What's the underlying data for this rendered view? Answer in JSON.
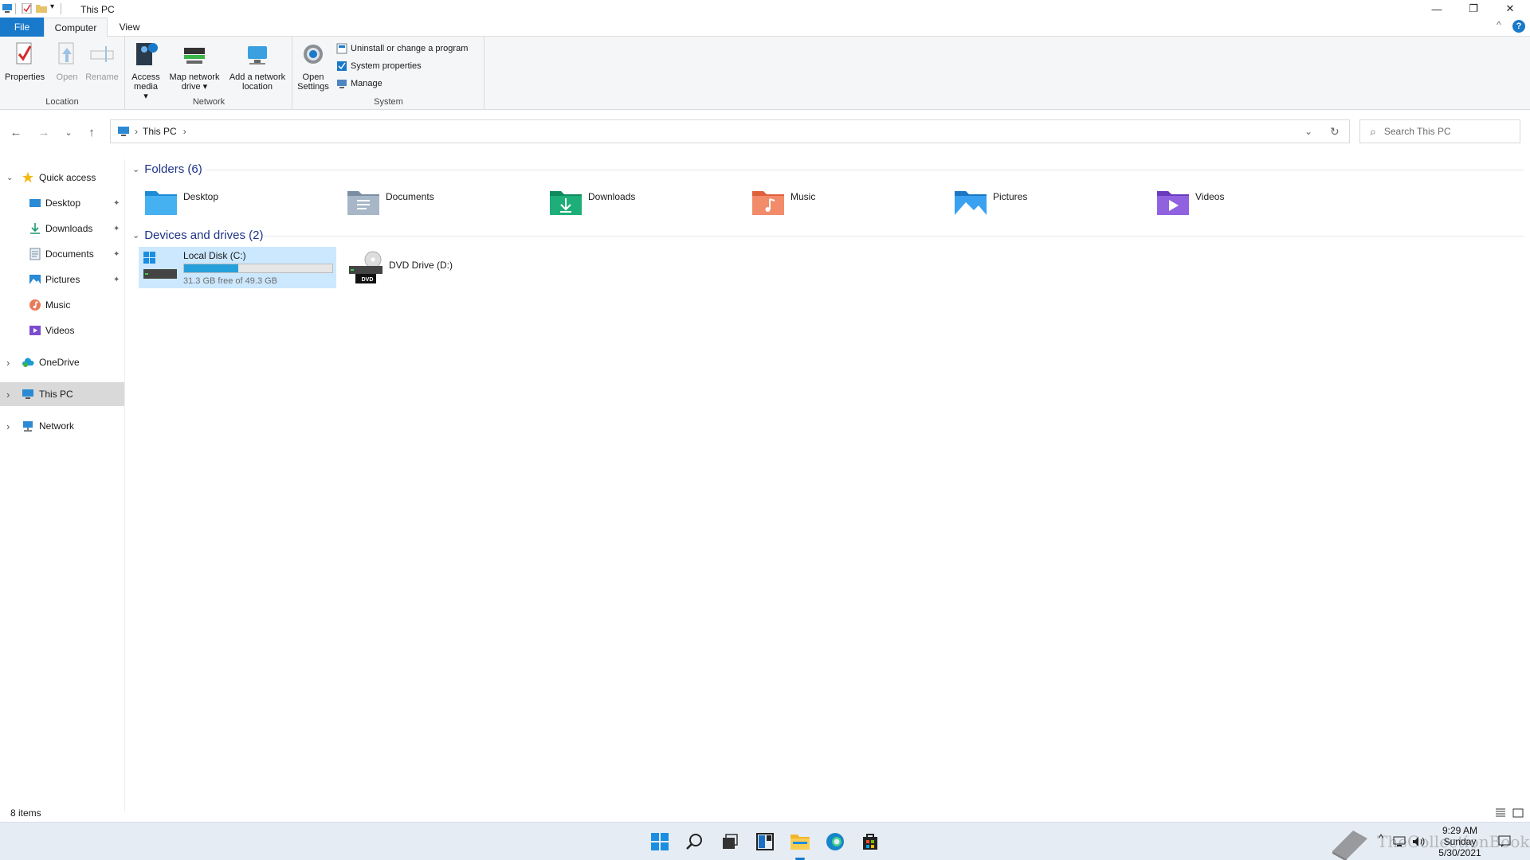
{
  "window": {
    "title": "This PC",
    "minimize_glyph": "—",
    "restore_glyph": "❐",
    "close_glyph": "✕",
    "help_glyph": "?",
    "collapse_glyph": "^"
  },
  "ribbon": {
    "tabs": {
      "file": "File",
      "computer": "Computer",
      "view": "View"
    },
    "location": {
      "label": "Location",
      "properties": "Properties",
      "open": "Open",
      "rename": "Rename"
    },
    "network": {
      "label": "Network",
      "access_media_1": "Access",
      "access_media_2": "media ▾",
      "map_drive_1": "Map network",
      "map_drive_2": "drive ▾",
      "add_location_1": "Add a network",
      "add_location_2": "location"
    },
    "system": {
      "label": "System",
      "open_settings_1": "Open",
      "open_settings_2": "Settings",
      "uninstall": "Uninstall or change a program",
      "system_properties": "System properties",
      "manage": "Manage"
    }
  },
  "nav": {
    "back_glyph": "←",
    "forward_glyph": "→",
    "recent_glyph": "⌄",
    "up_glyph": "↑",
    "breadcrumb_sep1": "›",
    "breadcrumb": "This PC",
    "breadcrumb_sep2": "›",
    "dropdown_glyph": "⌄",
    "refresh_glyph": "↻",
    "search_glyph": "⌕",
    "search_placeholder": "Search This PC"
  },
  "sidebar": {
    "quick_access": "Quick access",
    "items": [
      {
        "label": "Desktop",
        "pinned": true
      },
      {
        "label": "Downloads",
        "pinned": true
      },
      {
        "label": "Documents",
        "pinned": true
      },
      {
        "label": "Pictures",
        "pinned": true
      },
      {
        "label": "Music",
        "pinned": false
      },
      {
        "label": "Videos",
        "pinned": false
      }
    ],
    "pin_glyph": "📌",
    "onedrive": "OneDrive",
    "this_pc": "This PC",
    "network": "Network",
    "expanded_glyph": "⌄",
    "collapsed_glyph": "›"
  },
  "content": {
    "folders_header": "Folders (6)",
    "folders": [
      "Desktop",
      "Documents",
      "Downloads",
      "Music",
      "Pictures",
      "Videos"
    ],
    "drives_header": "Devices and drives (2)",
    "drives": [
      {
        "name": "Local Disk (C:)",
        "free_text": "31.3 GB free of 49.3 GB",
        "used_fraction": 0.365
      },
      {
        "name": "DVD Drive (D:)",
        "badge": "DVD"
      }
    ]
  },
  "status": {
    "items": "8 items"
  },
  "tray": {
    "time": "9:29 AM",
    "day": "Sunday",
    "date": "5/30/2021",
    "watermark": "TheCollectionBook"
  },
  "colors": {
    "accent": "#1979ca",
    "selection": "#cce8ff",
    "progress": "#26a0da",
    "header_text": "#1e3287"
  }
}
